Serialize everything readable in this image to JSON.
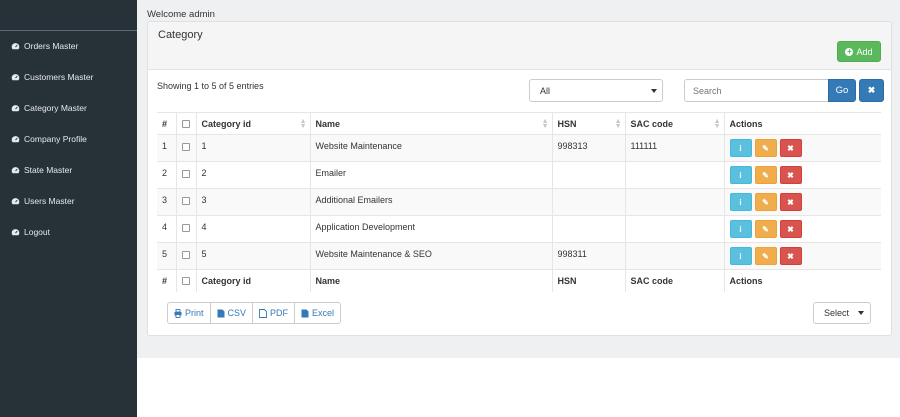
{
  "sidebar": {
    "items": [
      {
        "label": "Orders Master",
        "icon": "dashboard-icon"
      },
      {
        "label": "Customers Master",
        "icon": "dashboard-icon"
      },
      {
        "label": "Category Master",
        "icon": "dashboard-icon"
      },
      {
        "label": "Company Profile",
        "icon": "dashboard-icon"
      },
      {
        "label": "State Master",
        "icon": "dashboard-icon"
      },
      {
        "label": "Users Master",
        "icon": "dashboard-icon"
      },
      {
        "label": "Logout",
        "icon": "dashboard-icon"
      }
    ]
  },
  "header": {
    "welcome": "Welcome admin"
  },
  "panel": {
    "title": "Category",
    "add_label": "Add"
  },
  "toolbar": {
    "showing": "Showing 1 to 5 of 5 entries",
    "filter_value": "All",
    "search_placeholder": "Search",
    "go_label": "Go",
    "clear_label": "✖"
  },
  "table": {
    "columns": [
      "#",
      "",
      "Category id",
      "Name",
      "HSN",
      "SAC code",
      "Actions"
    ],
    "rows": [
      {
        "num": "1",
        "id": "1",
        "name": "Website Maintenance",
        "hsn": "998313",
        "sac": "111111"
      },
      {
        "num": "2",
        "id": "2",
        "name": "Emailer",
        "hsn": "",
        "sac": ""
      },
      {
        "num": "3",
        "id": "3",
        "name": "Additional Emailers",
        "hsn": "",
        "sac": ""
      },
      {
        "num": "4",
        "id": "4",
        "name": "Application Development",
        "hsn": "",
        "sac": ""
      },
      {
        "num": "5",
        "id": "5",
        "name": "Website Maintenance & SEO",
        "hsn": "998311",
        "sac": ""
      }
    ]
  },
  "footer": {
    "print_label": "Print",
    "csv_label": "CSV",
    "pdf_label": "PDF",
    "excel_label": "Excel",
    "page_select": "Select"
  },
  "colors": {
    "sidebar_bg": "#263238",
    "primary": "#337ab7",
    "success": "#5cb85c",
    "info": "#5bc0de",
    "warning": "#f0ad4e",
    "danger": "#d9534f"
  }
}
